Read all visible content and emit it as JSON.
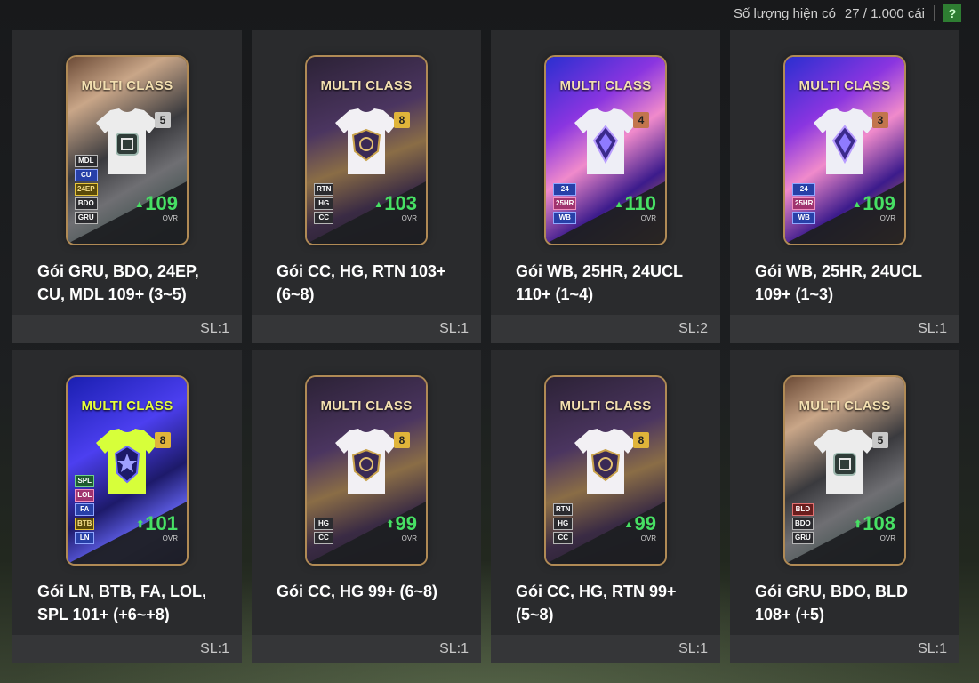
{
  "header": {
    "quantity_label": "Số lượng hiện có",
    "quantity_value": "27 / 1.000 cái",
    "help_label": "?"
  },
  "card_label": "MULTI CLASS",
  "ovr_label": "OVR",
  "packs": [
    {
      "title": "Gói GRU, BDO, 24EP, CU, MDL 109+ (3~5)",
      "count": "SL:1",
      "level": "5",
      "ovr": "109",
      "tags": [
        "MDL",
        "CU",
        "24EP",
        "BDO",
        "GRU"
      ]
    },
    {
      "title": "Gói CC, HG, RTN 103+ (6~8)",
      "count": "SL:1",
      "level": "8",
      "ovr": "103",
      "tags": [
        "RTN",
        "HG",
        "CC"
      ]
    },
    {
      "title": "Gói WB, 25HR, 24UCL 110+ (1~4)",
      "count": "SL:2",
      "level": "4",
      "ovr": "110",
      "tags": [
        "24",
        "25HR",
        "WB"
      ]
    },
    {
      "title": "Gói WB, 25HR, 24UCL 109+ (1~3)",
      "count": "SL:1",
      "level": "3",
      "ovr": "109",
      "tags": [
        "24",
        "25HR",
        "WB"
      ]
    },
    {
      "title": "Gói LN, BTB, FA, LOL, SPL 101+ (+6~+8)",
      "count": "SL:1",
      "level": "8",
      "ovr": "101",
      "tags": [
        "SPL",
        "LOL",
        "FA",
        "BTB",
        "LN"
      ]
    },
    {
      "title": "Gói CC, HG 99+ (6~8)",
      "count": "SL:1",
      "level": "8",
      "ovr": "99",
      "tags": [
        "HG",
        "CC"
      ]
    },
    {
      "title": "Gói CC, HG, RTN 99+ (5~8)",
      "count": "SL:1",
      "level": "8",
      "ovr": "99",
      "tags": [
        "RTN",
        "HG",
        "CC"
      ]
    },
    {
      "title": "Gói GRU, BDO, BLD 108+ (+5)",
      "count": "SL:1",
      "level": "5",
      "ovr": "108",
      "tags": [
        "BLD",
        "BDO",
        "GRU"
      ]
    }
  ],
  "colors": {
    "ovr_green": "#47e064",
    "help_green": "#2e7d32",
    "panel": "#2a2b2d"
  }
}
